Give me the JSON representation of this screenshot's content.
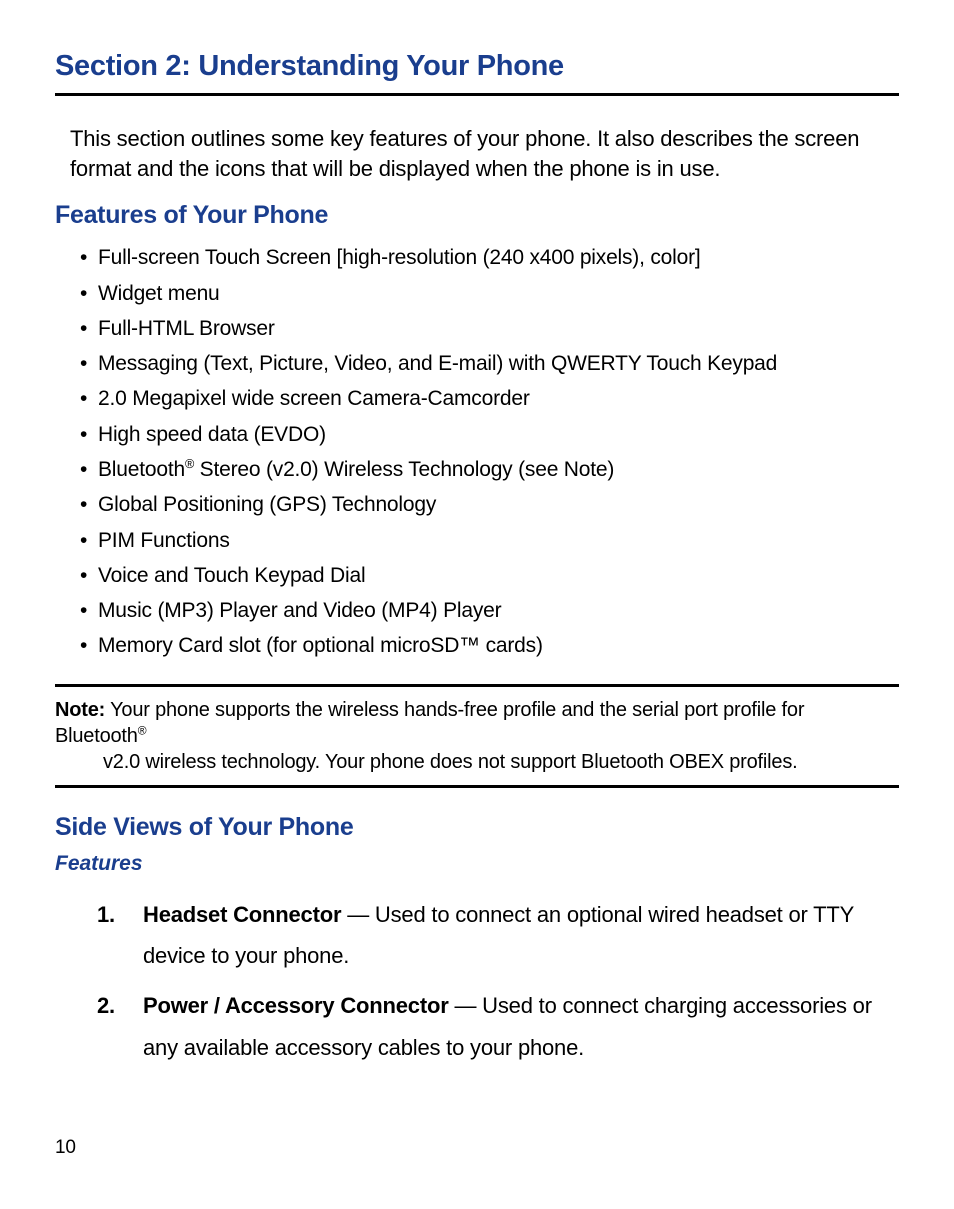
{
  "sectionTitle": "Section 2: Understanding Your Phone",
  "introText": "This section outlines some key features of your phone. It also describes the screen format and the icons that will be displayed when the phone is in use.",
  "featuresHeading": "Features of Your Phone",
  "features": {
    "item0": "Full-screen Touch Screen [high-resolution (240 x400 pixels), color]",
    "item1": "Widget menu",
    "item2": "Full-HTML Browser",
    "item3": "Messaging (Text, Picture, Video, and E-mail) with QWERTY Touch Keypad",
    "item4": "2.0 Megapixel wide screen Camera-Camcorder",
    "item5": "High speed data (EVDO)",
    "item6_pre": "Bluetooth",
    "item6_sup": "®",
    "item6_post": " Stereo (v2.0) Wireless Technology (see Note)",
    "item7": "Global Positioning (GPS) Technology",
    "item8": "PIM Functions",
    "item9": "Voice and Touch Keypad Dial",
    "item10": "Music (MP3) Player and Video (MP4) Player",
    "item11": " Memory Card slot (for optional microSD™ cards)"
  },
  "note": {
    "label": "Note:",
    "line1_pre": " Your phone supports the wireless hands-free profile and the serial port profile for Bluetooth",
    "line1_sup": "®",
    "line2": "v2.0 wireless technology. Your phone does not support Bluetooth OBEX profiles."
  },
  "sideViewsHeading": "Side Views of Your Phone",
  "featuresSubheading": "Features",
  "numberedItems": {
    "n1_marker": "1.",
    "n1_title": "Headset Connector",
    "n1_text": " — Used to connect an optional wired headset or TTY device to your phone.",
    "n2_marker": "2.",
    "n2_title": "Power / Accessory Connector",
    "n2_text": " — Used to connect charging accessories or any available accessory cables to your phone."
  },
  "pageNumber": "10"
}
